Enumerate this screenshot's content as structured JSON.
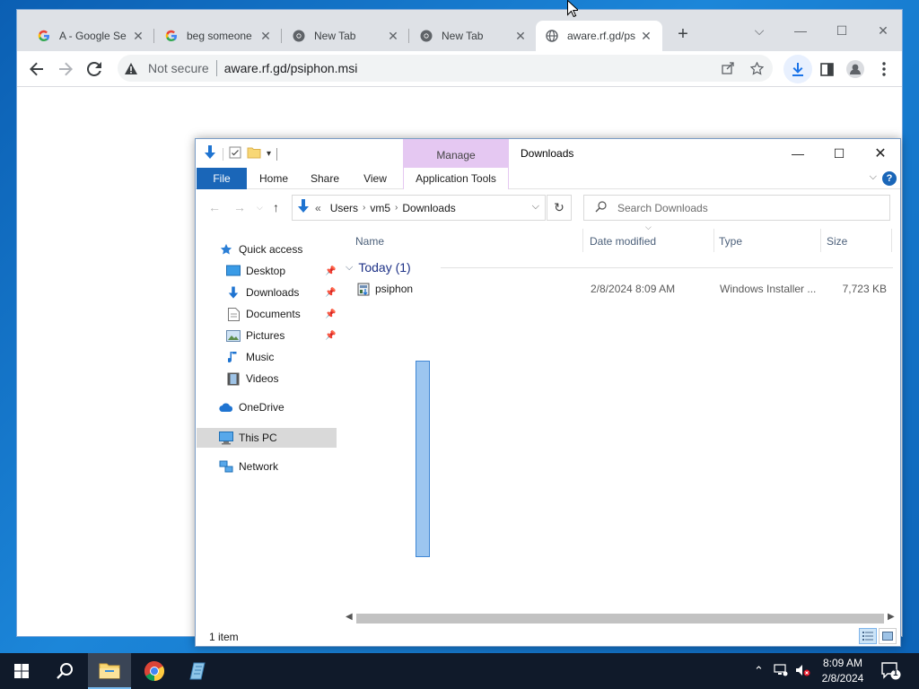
{
  "chrome": {
    "tabs": [
      {
        "title": "A - Google Se",
        "favicon": "google-g-icon"
      },
      {
        "title": "beg someone",
        "favicon": "google-g-icon"
      },
      {
        "title": "New Tab",
        "favicon": "chrome-icon"
      },
      {
        "title": "New Tab",
        "favicon": "chrome-icon"
      },
      {
        "title": "aware.rf.gd/ps",
        "favicon": "globe-icon"
      }
    ],
    "security": "Not secure",
    "url": "aware.rf.gd/psiphon.msi"
  },
  "explorer": {
    "title": "Downloads",
    "context_tab": "Manage",
    "ribbon_tabs": [
      "File",
      "Home",
      "Share",
      "View",
      "Application Tools"
    ],
    "breadcrumb": [
      "Users",
      "vm5",
      "Downloads"
    ],
    "breadcrumb_prefix": "«",
    "search_placeholder": "Search Downloads",
    "nav": {
      "quick_access": "Quick access",
      "desktop": "Desktop",
      "downloads": "Downloads",
      "documents": "Documents",
      "pictures": "Pictures",
      "music": "Music",
      "videos": "Videos",
      "onedrive": "OneDrive",
      "this_pc": "This PC",
      "network": "Network"
    },
    "columns": {
      "name": "Name",
      "date": "Date modified",
      "type": "Type",
      "size": "Size"
    },
    "group": "Today (1)",
    "files": [
      {
        "name": "psiphon",
        "date": "2/8/2024 8:09 AM",
        "type": "Windows Installer ...",
        "size": "7,723 KB"
      }
    ],
    "status": "1 item"
  },
  "taskbar": {
    "time": "8:09 AM",
    "date": "2/8/2024",
    "notifications": "1"
  }
}
